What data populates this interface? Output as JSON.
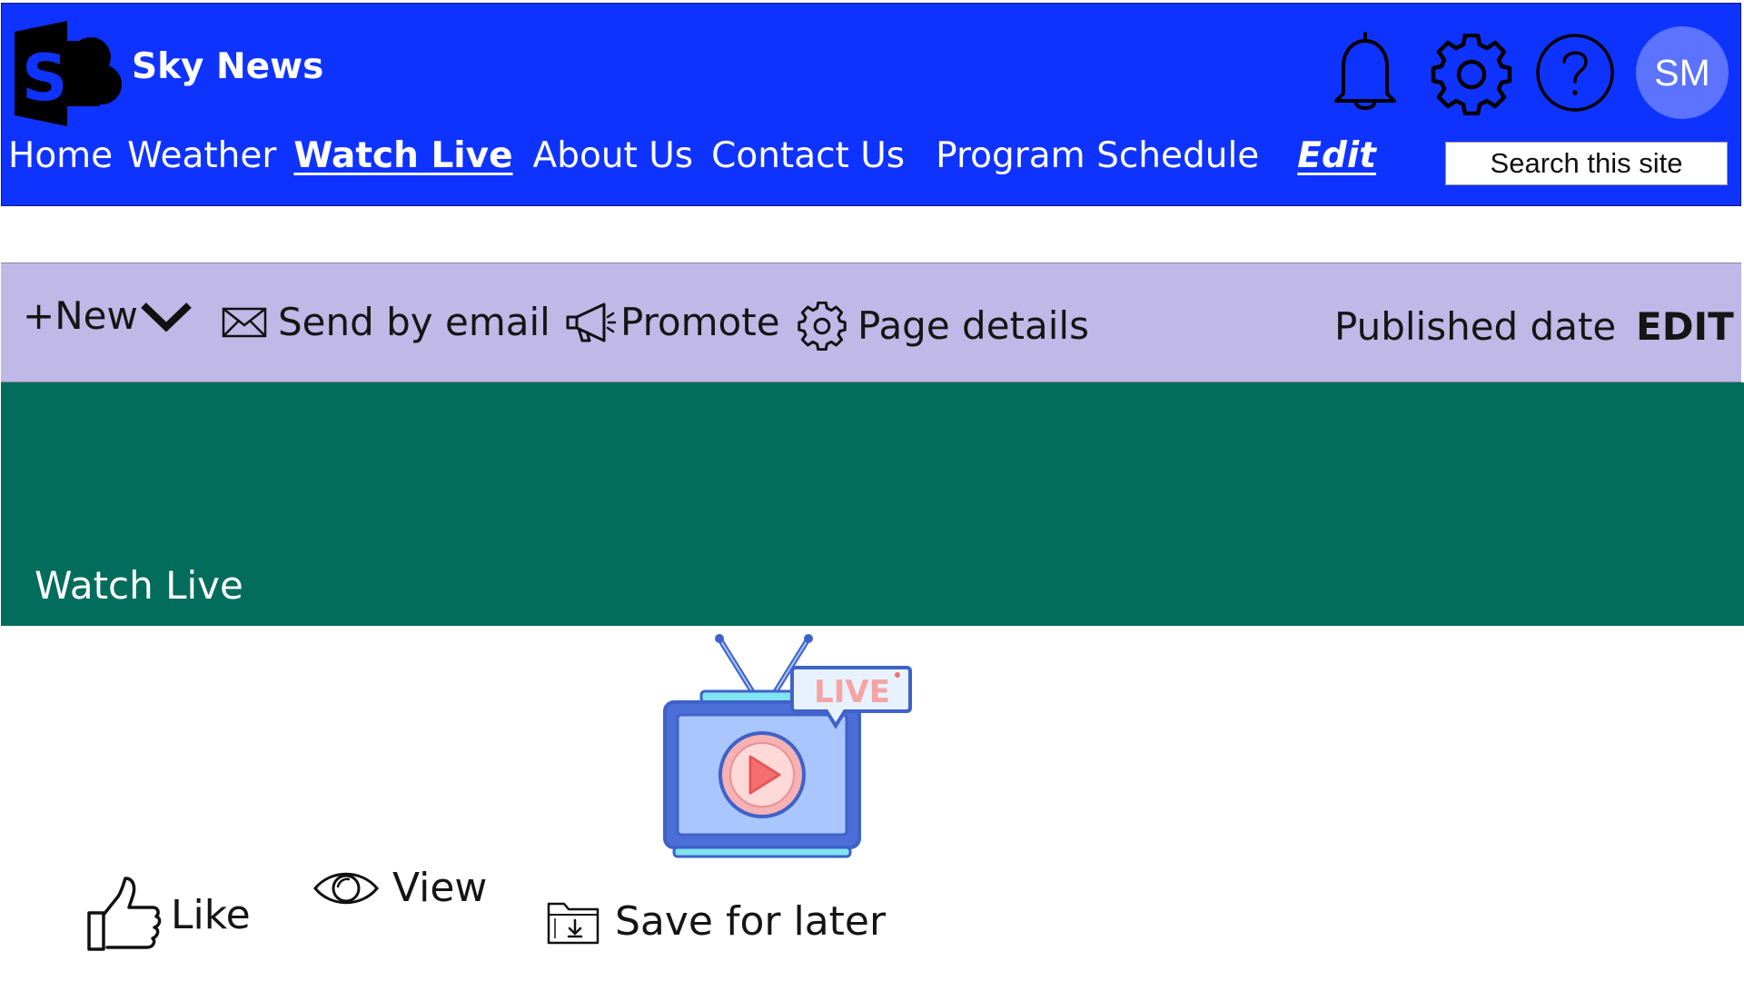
{
  "header": {
    "site_title": "Sky News",
    "avatar_initials": "SM",
    "search_placeholder": "Search this site",
    "nav": [
      {
        "label": "Home"
      },
      {
        "label": "Weather"
      },
      {
        "label": "Watch Live",
        "active": true
      },
      {
        "label": "About Us"
      },
      {
        "label": "Contact Us"
      },
      {
        "label": "Program Schedule"
      }
    ],
    "edit_label": "Edit",
    "icons": [
      "sharepoint-logo-icon",
      "bell-icon",
      "gear-icon",
      "help-icon"
    ]
  },
  "command_bar": {
    "new_label": "+New",
    "send_label": "Send by email",
    "promote_label": "Promote",
    "details_label": "Page details",
    "published_label": "Published date",
    "edit_label": "EDIT"
  },
  "banner": {
    "title": "Watch Live",
    "color": "#026d5c"
  },
  "illustration": {
    "badge_text": "LIVE",
    "icon": "live-tv-icon"
  },
  "actions": {
    "like_label": "Like",
    "view_label": "View",
    "save_label": "Save for later"
  },
  "colors": {
    "header_bg": "#0f33ff",
    "command_bar_bg": "#c0b8e6",
    "avatar_bg": "#5b73ff"
  }
}
